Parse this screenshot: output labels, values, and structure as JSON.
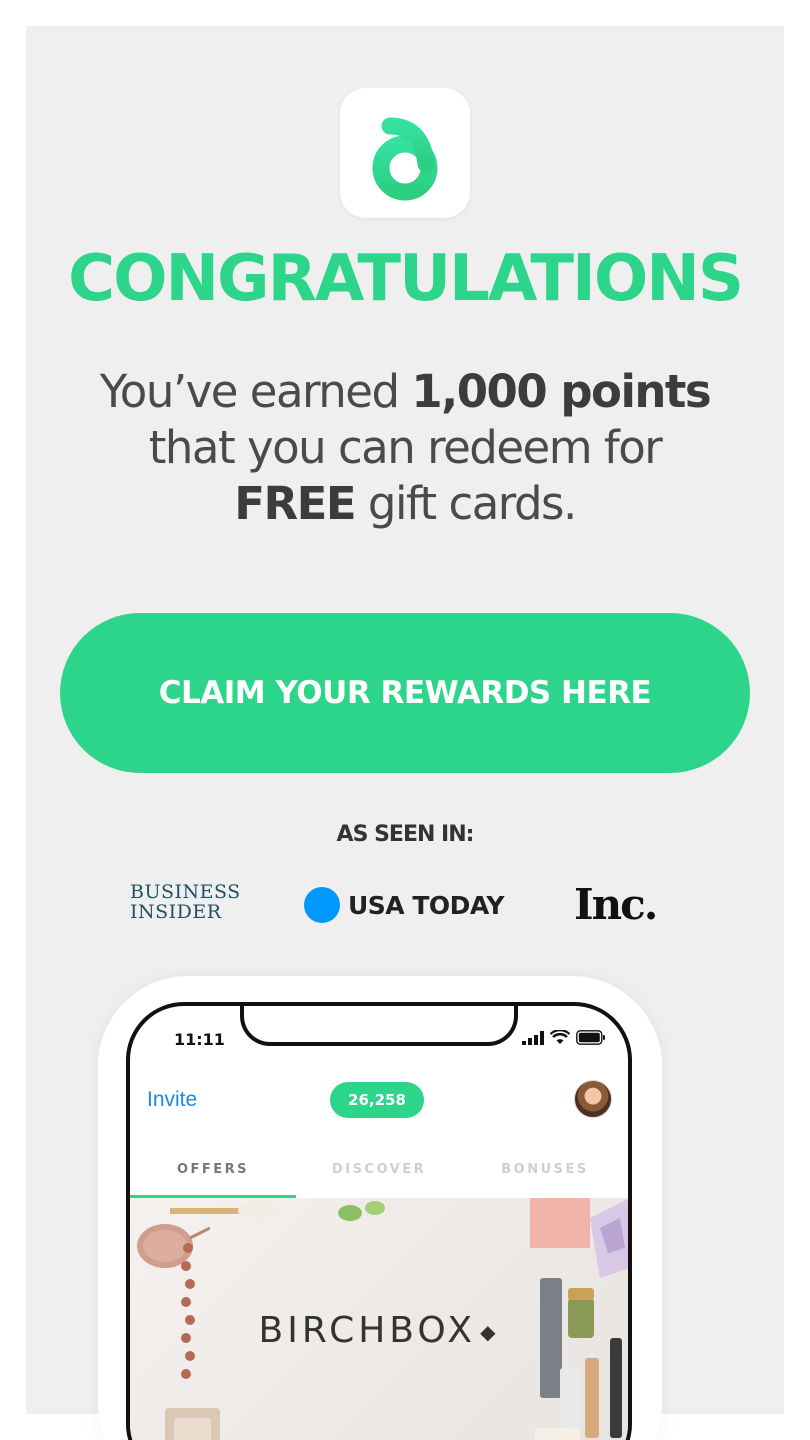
{
  "headline": "CONGRATULATIONS",
  "subtitle": {
    "line1_pre": "You’ve earned ",
    "line1_bold": "1,000 points",
    "line2": "that you can redeem for",
    "line3_bold": "FREE",
    "line3_post": " gift cards."
  },
  "cta": {
    "label": "CLAIM YOUR REWARDS HERE"
  },
  "press": {
    "heading": "AS SEEN IN:",
    "business_insider_line1": "BUSINESS",
    "business_insider_line2": "INSIDER",
    "usa_today": "USA TODAY",
    "inc": "Inc."
  },
  "phone": {
    "time": "11:11",
    "invite": "Invite",
    "points": "26,258",
    "tabs": [
      {
        "label": "OFFERS",
        "active": true
      },
      {
        "label": "DISCOVER",
        "active": false
      },
      {
        "label": "BONUSES",
        "active": false
      }
    ],
    "banner_brand": "BIRCHBOX",
    "banner_diamond": "◆"
  },
  "colors": {
    "brand_green": "#2dd58a",
    "link_blue": "#1a8ce6",
    "usa_today_blue": "#0098ff",
    "panel_bg": "#efefef"
  }
}
